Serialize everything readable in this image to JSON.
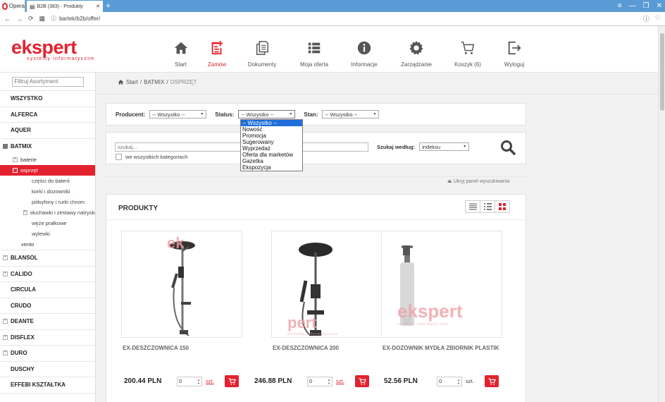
{
  "browser": {
    "opera_label": "Opera",
    "tab_title": "B2B (383) - Produkty",
    "new_tab": "+",
    "url": "bartek/b2b/offer/"
  },
  "logo": {
    "main": "ekspert",
    "sub": "systemy informatyczne"
  },
  "nav": [
    {
      "label": "Start",
      "icon": "home-icon"
    },
    {
      "label": "Zamów",
      "icon": "order-icon",
      "active": true
    },
    {
      "label": "Dokumenty",
      "icon": "documents-icon"
    },
    {
      "label": "Moja oferta",
      "icon": "list-icon"
    },
    {
      "label": "Informacje",
      "icon": "info-icon"
    },
    {
      "label": "Zarządzanie",
      "icon": "gear-icon"
    },
    {
      "label": "Koszyk (6)",
      "icon": "cart-icon"
    },
    {
      "label": "Wyloguj",
      "icon": "logout-icon"
    }
  ],
  "sidebar": {
    "filter_placeholder": "Filtruj Asortyment",
    "brands_top": [
      "WSZYSTKO",
      "ALFERCA",
      "AQUER"
    ],
    "batmix": {
      "label": "BATMIX",
      "items": {
        "baterie": "baterie",
        "osprzet": "osprzęt",
        "czesci": "części do baterii",
        "korki": "korki i dozowniki",
        "polsyfony": "półsyfony i rurki chrom",
        "sluchawki": "słuchawki i zestawy natryskowe",
        "weze": "węże prałkowe",
        "wylewki": "wylewki",
        "vento": "vento"
      }
    },
    "brands_bottom": [
      {
        "label": "BLANSOL",
        "exp": true
      },
      {
        "label": "CALIDO",
        "exp": true
      },
      {
        "label": "CIRCULA",
        "exp": false
      },
      {
        "label": "CRUDO",
        "exp": false
      },
      {
        "label": "DEANTE",
        "exp": true
      },
      {
        "label": "DISFLEX",
        "exp": true
      },
      {
        "label": "DURO",
        "exp": true
      },
      {
        "label": "DUSCHY",
        "exp": false
      },
      {
        "label": "EFFEBI KSZTAŁTKA",
        "exp": false
      }
    ]
  },
  "breadcrumb": {
    "start": "Start",
    "sep": "/",
    "level1": "BATMIX",
    "current": "OSPRZĘT"
  },
  "filters": {
    "producer_label": "Producent:",
    "producer_value": "-- Wszystko --",
    "status_label": "Status:",
    "status_value": "-- Wszystko --",
    "stan_label": "Stan:",
    "stan_value": "-- Wszystko --"
  },
  "status_options": [
    "-- Wszystko --",
    "Nowość",
    "Promocja",
    "Sugerowany",
    "Wyprzedaż",
    "Oferta dla marketów",
    "Gazetka",
    "Ekspozycja"
  ],
  "search": {
    "placeholder": "szukaj...",
    "all_categories": "we wszystkich kategoriach",
    "search_by_label": "Szukaj według:",
    "search_by_value": "indeksu",
    "hide_panel": "Ukryj panel wyszukiwania"
  },
  "products": {
    "title": "PRODUKTY",
    "items": [
      {
        "name": "EX-DESZCZOWNICA 150",
        "price": "200.44 PLN",
        "qty": "0",
        "unit": "szt.",
        "unit_link": true
      },
      {
        "name": "EX-DESZCZOWNICA 200",
        "price": "246.88 PLN",
        "qty": "0",
        "unit": "szt.",
        "unit_link": true
      },
      {
        "name": "EX-DOZOWNIK MYDŁA ZBIORNIK PLASTIK",
        "price": "52.56 PLN",
        "qty": "0",
        "unit": "szt.",
        "unit_link": false
      }
    ]
  },
  "colors": {
    "brand_red": "#e3222f",
    "select_blue": "#1e6fd9",
    "tab_blue": "#5b9bd5"
  }
}
